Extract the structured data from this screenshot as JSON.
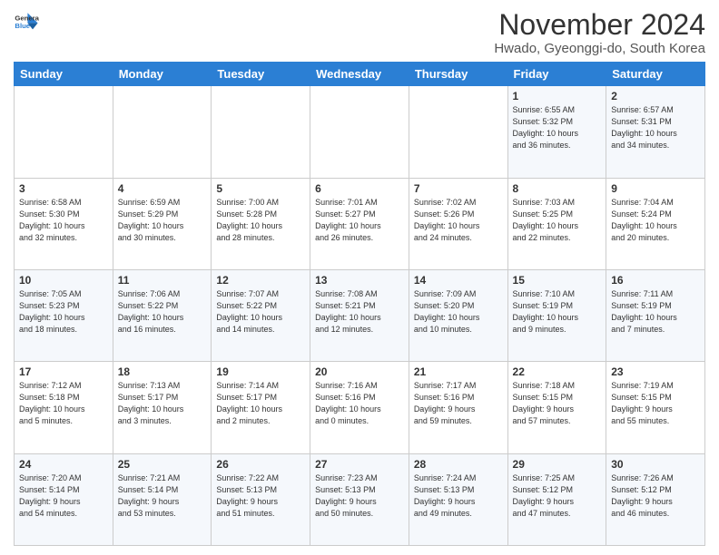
{
  "logo": {
    "line1": "General",
    "line2": "Blue"
  },
  "title": "November 2024",
  "location": "Hwado, Gyeonggi-do, South Korea",
  "days_header": [
    "Sunday",
    "Monday",
    "Tuesday",
    "Wednesday",
    "Thursday",
    "Friday",
    "Saturday"
  ],
  "weeks": [
    [
      {
        "num": "",
        "info": ""
      },
      {
        "num": "",
        "info": ""
      },
      {
        "num": "",
        "info": ""
      },
      {
        "num": "",
        "info": ""
      },
      {
        "num": "",
        "info": ""
      },
      {
        "num": "1",
        "info": "Sunrise: 6:55 AM\nSunset: 5:32 PM\nDaylight: 10 hours\nand 36 minutes."
      },
      {
        "num": "2",
        "info": "Sunrise: 6:57 AM\nSunset: 5:31 PM\nDaylight: 10 hours\nand 34 minutes."
      }
    ],
    [
      {
        "num": "3",
        "info": "Sunrise: 6:58 AM\nSunset: 5:30 PM\nDaylight: 10 hours\nand 32 minutes."
      },
      {
        "num": "4",
        "info": "Sunrise: 6:59 AM\nSunset: 5:29 PM\nDaylight: 10 hours\nand 30 minutes."
      },
      {
        "num": "5",
        "info": "Sunrise: 7:00 AM\nSunset: 5:28 PM\nDaylight: 10 hours\nand 28 minutes."
      },
      {
        "num": "6",
        "info": "Sunrise: 7:01 AM\nSunset: 5:27 PM\nDaylight: 10 hours\nand 26 minutes."
      },
      {
        "num": "7",
        "info": "Sunrise: 7:02 AM\nSunset: 5:26 PM\nDaylight: 10 hours\nand 24 minutes."
      },
      {
        "num": "8",
        "info": "Sunrise: 7:03 AM\nSunset: 5:25 PM\nDaylight: 10 hours\nand 22 minutes."
      },
      {
        "num": "9",
        "info": "Sunrise: 7:04 AM\nSunset: 5:24 PM\nDaylight: 10 hours\nand 20 minutes."
      }
    ],
    [
      {
        "num": "10",
        "info": "Sunrise: 7:05 AM\nSunset: 5:23 PM\nDaylight: 10 hours\nand 18 minutes."
      },
      {
        "num": "11",
        "info": "Sunrise: 7:06 AM\nSunset: 5:22 PM\nDaylight: 10 hours\nand 16 minutes."
      },
      {
        "num": "12",
        "info": "Sunrise: 7:07 AM\nSunset: 5:22 PM\nDaylight: 10 hours\nand 14 minutes."
      },
      {
        "num": "13",
        "info": "Sunrise: 7:08 AM\nSunset: 5:21 PM\nDaylight: 10 hours\nand 12 minutes."
      },
      {
        "num": "14",
        "info": "Sunrise: 7:09 AM\nSunset: 5:20 PM\nDaylight: 10 hours\nand 10 minutes."
      },
      {
        "num": "15",
        "info": "Sunrise: 7:10 AM\nSunset: 5:19 PM\nDaylight: 10 hours\nand 9 minutes."
      },
      {
        "num": "16",
        "info": "Sunrise: 7:11 AM\nSunset: 5:19 PM\nDaylight: 10 hours\nand 7 minutes."
      }
    ],
    [
      {
        "num": "17",
        "info": "Sunrise: 7:12 AM\nSunset: 5:18 PM\nDaylight: 10 hours\nand 5 minutes."
      },
      {
        "num": "18",
        "info": "Sunrise: 7:13 AM\nSunset: 5:17 PM\nDaylight: 10 hours\nand 3 minutes."
      },
      {
        "num": "19",
        "info": "Sunrise: 7:14 AM\nSunset: 5:17 PM\nDaylight: 10 hours\nand 2 minutes."
      },
      {
        "num": "20",
        "info": "Sunrise: 7:16 AM\nSunset: 5:16 PM\nDaylight: 10 hours\nand 0 minutes."
      },
      {
        "num": "21",
        "info": "Sunrise: 7:17 AM\nSunset: 5:16 PM\nDaylight: 9 hours\nand 59 minutes."
      },
      {
        "num": "22",
        "info": "Sunrise: 7:18 AM\nSunset: 5:15 PM\nDaylight: 9 hours\nand 57 minutes."
      },
      {
        "num": "23",
        "info": "Sunrise: 7:19 AM\nSunset: 5:15 PM\nDaylight: 9 hours\nand 55 minutes."
      }
    ],
    [
      {
        "num": "24",
        "info": "Sunrise: 7:20 AM\nSunset: 5:14 PM\nDaylight: 9 hours\nand 54 minutes."
      },
      {
        "num": "25",
        "info": "Sunrise: 7:21 AM\nSunset: 5:14 PM\nDaylight: 9 hours\nand 53 minutes."
      },
      {
        "num": "26",
        "info": "Sunrise: 7:22 AM\nSunset: 5:13 PM\nDaylight: 9 hours\nand 51 minutes."
      },
      {
        "num": "27",
        "info": "Sunrise: 7:23 AM\nSunset: 5:13 PM\nDaylight: 9 hours\nand 50 minutes."
      },
      {
        "num": "28",
        "info": "Sunrise: 7:24 AM\nSunset: 5:13 PM\nDaylight: 9 hours\nand 49 minutes."
      },
      {
        "num": "29",
        "info": "Sunrise: 7:25 AM\nSunset: 5:12 PM\nDaylight: 9 hours\nand 47 minutes."
      },
      {
        "num": "30",
        "info": "Sunrise: 7:26 AM\nSunset: 5:12 PM\nDaylight: 9 hours\nand 46 minutes."
      }
    ]
  ]
}
